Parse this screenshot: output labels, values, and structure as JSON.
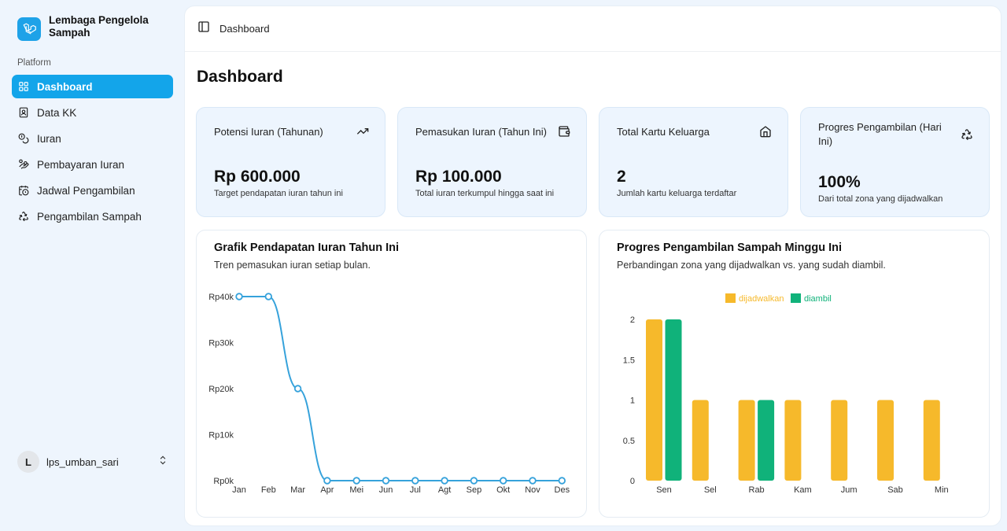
{
  "sidebar": {
    "brand": "Lembaga Pengelola Sampah",
    "section": "Platform",
    "items": [
      {
        "label": "Dashboard",
        "icon": "grid-icon",
        "active": true
      },
      {
        "label": "Data KK",
        "icon": "contact-card-icon"
      },
      {
        "label": "Iuran",
        "icon": "coins-icon"
      },
      {
        "label": "Pembayaran Iuran",
        "icon": "hand-coins-icon"
      },
      {
        "label": "Jadwal Pengambilan",
        "icon": "calendar-clock-icon"
      },
      {
        "label": "Pengambilan Sampah",
        "icon": "recycle-icon"
      }
    ],
    "user": {
      "initial": "L",
      "name": "lps_umban_sari"
    }
  },
  "header": {
    "breadcrumb": "Dashboard"
  },
  "page_title": "Dashboard",
  "cards": [
    {
      "title": "Potensi Iuran (Tahunan)",
      "value": "Rp 600.000",
      "sub": "Target pendapatan iuran tahun ini",
      "icon": "trending-up-icon"
    },
    {
      "title": "Pemasukan Iuran (Tahun Ini)",
      "value": "Rp 100.000",
      "sub": "Total iuran terkumpul hingga saat ini",
      "icon": "wallet-icon"
    },
    {
      "title": "Total Kartu Keluarga",
      "value": "2",
      "sub": "Jumlah kartu keluarga terdaftar",
      "icon": "home-icon"
    },
    {
      "title": "Progres Pengambilan (Hari Ini)",
      "value": "100%",
      "sub": "Dari total zona yang dijadwalkan",
      "icon": "recycle-icon"
    }
  ],
  "panels": {
    "income": {
      "title": "Grafik Pendapatan Iuran Tahun Ini",
      "subtitle": "Tren pemasukan iuran setiap bulan."
    },
    "pickup": {
      "title": "Progres Pengambilan Sampah Minggu Ini",
      "subtitle": "Perbandingan zona yang dijadwalkan vs. yang sudah diambil."
    }
  },
  "colors": {
    "accent": "#13a5ea",
    "line": "#36a2db",
    "scheduled": "#f6b92b",
    "taken": "#10b27a"
  },
  "chart_data": [
    {
      "type": "line",
      "title": "Grafik Pendapatan Iuran Tahun Ini",
      "categories": [
        "Jan",
        "Feb",
        "Mar",
        "Apr",
        "Mei",
        "Jun",
        "Jul",
        "Agt",
        "Sep",
        "Okt",
        "Nov",
        "Des"
      ],
      "values": [
        40000,
        40000,
        20000,
        0,
        0,
        0,
        0,
        0,
        0,
        0,
        0,
        0
      ],
      "yticks": [
        0,
        10000,
        20000,
        30000,
        40000
      ],
      "ytick_labels": [
        "Rp0k",
        "Rp10k",
        "Rp20k",
        "Rp30k",
        "Rp40k"
      ],
      "ylim": [
        0,
        40000
      ],
      "grid": false
    },
    {
      "type": "bar",
      "title": "Progres Pengambilan Sampah Minggu Ini",
      "categories": [
        "Sen",
        "Sel",
        "Rab",
        "Kam",
        "Jum",
        "Sab",
        "Min"
      ],
      "series": [
        {
          "name": "dijadwalkan",
          "values": [
            2,
            1,
            1,
            1,
            1,
            1,
            1
          ]
        },
        {
          "name": "diambil",
          "values": [
            2,
            0,
            1,
            0,
            0,
            0,
            0
          ]
        }
      ],
      "yticks": [
        0,
        0.5,
        1,
        1.5,
        2
      ],
      "ylim": [
        0,
        2
      ],
      "legend": "top-center",
      "grid": false
    }
  ]
}
